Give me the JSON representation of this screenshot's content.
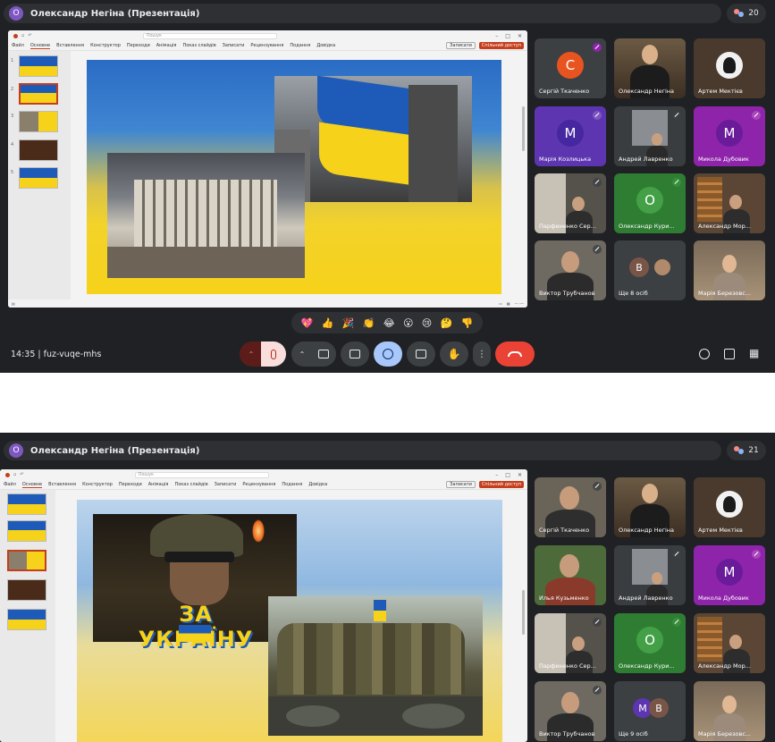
{
  "meeting1": {
    "presenter_title": "Олександр Негіна (Презентація)",
    "avatar_letter": "O",
    "participant_count": "20",
    "time": "14:35",
    "meeting_code": "fuz-vuqe-mhs",
    "reactions": [
      "💖",
      "👍",
      "🎉",
      "👏",
      "😂",
      "😮",
      "😢",
      "🤔",
      "👎"
    ],
    "tiles": [
      {
        "name": "Сергій Ткаченко",
        "letter": "C",
        "color": "#e8541f"
      },
      {
        "name": "Олександр Негіна"
      },
      {
        "name": "Артем Мектієв"
      },
      {
        "name": "Марія Козлицька",
        "letter": "M",
        "color": "#5e35b1"
      },
      {
        "name": "Андрей Лавренко"
      },
      {
        "name": "Микола Дубовик",
        "letter": "M",
        "color": "#8e24aa"
      },
      {
        "name": "Парфененко Сер..."
      },
      {
        "name": "Олександр Кури...",
        "letter": "O",
        "color": "#43a047"
      },
      {
        "name": "Александр Мор..."
      },
      {
        "name": "Виктор Трубчанов"
      },
      {
        "name": "Ще 8 осіб",
        "letter": "B",
        "color": "#795548"
      },
      {
        "name": "Марія Березовс..."
      }
    ]
  },
  "meeting2": {
    "presenter_title": "Олександр Негіна (Презентація)",
    "avatar_letter": "O",
    "participant_count": "21",
    "slide_caption": "ЗА УКРАЇНУ",
    "tiles": [
      {
        "name": "Сергій Ткаченко"
      },
      {
        "name": "Олександр Негіна"
      },
      {
        "name": "Артем Мектієв"
      },
      {
        "name": "Илья Кузьменко"
      },
      {
        "name": "Андрей Лавренко"
      },
      {
        "name": "Микола Дубовик",
        "letter": "M",
        "color": "#8e24aa"
      },
      {
        "name": "Парфененко Сер..."
      },
      {
        "name": "Олександр Кури...",
        "letter": "O",
        "color": "#43a047"
      },
      {
        "name": "Александр Мор..."
      },
      {
        "name": "Виктор Трубчанов"
      },
      {
        "name": "Ще 9 осіб",
        "letter": "M",
        "color": "#5e35b1"
      },
      {
        "name": "Марія Березовс..."
      }
    ]
  },
  "powerpoint": {
    "menu": [
      "Файл",
      "Основне",
      "Вставлення",
      "Конструктор",
      "Переходи",
      "Анімація",
      "Показ слайдів",
      "Записати",
      "Рецензування",
      "Подання",
      "Довідка"
    ],
    "search_placeholder": "Пошук",
    "record_label": "Записати",
    "share_label": "Спільний доступ"
  },
  "colors": {
    "meet_bg": "#202124",
    "hangup": "#ea4335",
    "flag_blue": "#1e5bb8",
    "flag_yellow": "#f6d21a"
  }
}
